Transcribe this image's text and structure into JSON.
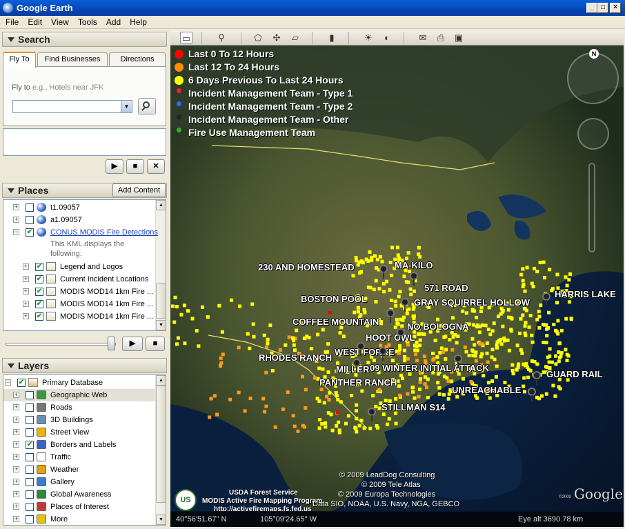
{
  "window": {
    "title": "Google Earth"
  },
  "menu": [
    "File",
    "Edit",
    "View",
    "Tools",
    "Add",
    "Help"
  ],
  "search": {
    "header": "Search",
    "tabs": [
      "Fly To",
      "Find Businesses",
      "Directions"
    ],
    "flyto_label": "Fly to",
    "flyto_hint": "e.g., Hotels near JFK",
    "input_value": ""
  },
  "places": {
    "header": "Places",
    "add_content": "Add Content",
    "items": [
      {
        "label": "t1.09057",
        "checked": false,
        "expanded": false,
        "icon": "kml-globe-icon"
      },
      {
        "label": "a1.09057",
        "checked": false,
        "expanded": false,
        "icon": "kml-globe-icon"
      },
      {
        "label": "CONUS MODIS Fire Detections",
        "checked": true,
        "expanded": true,
        "icon": "kml-globe-icon",
        "link": true
      },
      {
        "label": "Legend and Logos",
        "checked": true,
        "expanded": false,
        "icon": "folder-icon"
      },
      {
        "label": "Current Incident Locations",
        "checked": true,
        "expanded": false,
        "icon": "folder-icon"
      },
      {
        "label": "MODIS MOD14 1km Fire ...",
        "checked": true,
        "expanded": false,
        "icon": "folder-icon"
      },
      {
        "label": "MODIS MOD14 1km Fire ...",
        "checked": true,
        "expanded": false,
        "icon": "folder-icon"
      },
      {
        "label": "MODIS MOD14 1km Fire ...",
        "checked": true,
        "expanded": false,
        "icon": "folder-icon"
      }
    ],
    "description_line1": "This KML displays the",
    "description_line2": "following:"
  },
  "layers": {
    "header": "Layers",
    "root": "Primary Database",
    "items": [
      {
        "label": "Geographic Web",
        "checked": false,
        "icon": "geographic-web-icon",
        "color": "#3a9a3a"
      },
      {
        "label": "Roads",
        "checked": false,
        "icon": "roads-icon",
        "color": "#777777"
      },
      {
        "label": "3D Buildings",
        "checked": false,
        "icon": "3d-buildings-icon",
        "color": "#6a8fb0"
      },
      {
        "label": "Street View",
        "checked": false,
        "icon": "street-view-icon",
        "color": "#f0b400"
      },
      {
        "label": "Borders and Labels",
        "checked": true,
        "icon": "borders-labels-icon",
        "color": "#3366cc"
      },
      {
        "label": "Traffic",
        "checked": false,
        "icon": "traffic-icon",
        "color": "#ffffff"
      },
      {
        "label": "Weather",
        "checked": false,
        "icon": "weather-icon",
        "color": "#e8a000"
      },
      {
        "label": "Gallery",
        "checked": false,
        "icon": "gallery-icon",
        "color": "#3a7ad8"
      },
      {
        "label": "Global Awareness",
        "checked": false,
        "icon": "global-awareness-icon",
        "color": "#2c8a3a"
      },
      {
        "label": "Places of Interest",
        "checked": false,
        "icon": "places-of-interest-icon",
        "color": "#cc3333"
      },
      {
        "label": "More",
        "checked": false,
        "icon": "more-icon",
        "color": "#e8c000"
      }
    ]
  },
  "legend": [
    {
      "label": "Last 0 To 12 Hours",
      "kind": "dot",
      "color": "#ff0000"
    },
    {
      "label": "Last 12 To 24 Hours",
      "kind": "dot",
      "color": "#ff8c00"
    },
    {
      "label": "6 Days Previous To Last 24 Hours",
      "kind": "dot",
      "color": "#ffff00"
    },
    {
      "label": "Incident Management Team - Type 1",
      "kind": "pin",
      "color": "#ff2020"
    },
    {
      "label": "Incident Management Team - Type 2",
      "kind": "pin",
      "color": "#2a6bff"
    },
    {
      "label": "Incident Management Team - Other",
      "kind": "pin",
      "color": "#222222"
    },
    {
      "label": "Fire Use Management Team",
      "kind": "pin",
      "color": "#30b030"
    }
  ],
  "fire_labels": [
    "230 AND HOMESTEAD",
    "MA-KILO",
    "571 ROAD",
    "BOSTON POOL",
    "GRAY SQUIRREL HOLLOW",
    "HARRIS LAKE",
    "COFFEE MOUNTAIN",
    "NO BOLOGNA",
    "HOOT OWL",
    "RHODES RANCH",
    "WEST FORKE",
    "MILLER",
    "09 WINTER INITIAL ATTACK",
    "GUARD RAIL",
    "PANTHER RANCH",
    "UNREACHABLE",
    "STILLMAN S14"
  ],
  "credits": {
    "usfs_line1": "USDA Forest Service",
    "usfs_line2": "MODIS Active Fire Mapping Program",
    "usfs_line3": "http://activefiremaps.fs.fed.us",
    "c1": "© 2009 LeadDog Consulting",
    "c2": "© 2009 Tele Atlas",
    "c3": "© 2009 Europa Technologies",
    "c4": "Data SIO, NOAA, U.S. Navy, NGA, GEBCO",
    "logo": "Google",
    "logo_small": "©2009",
    "compass_n": "N",
    "usfs_badge": "US"
  },
  "status": {
    "lat": "40°56'51.67\" N",
    "lon": "105°09'24.65\" W",
    "eye_alt": "Eye alt  3690.78 km"
  }
}
